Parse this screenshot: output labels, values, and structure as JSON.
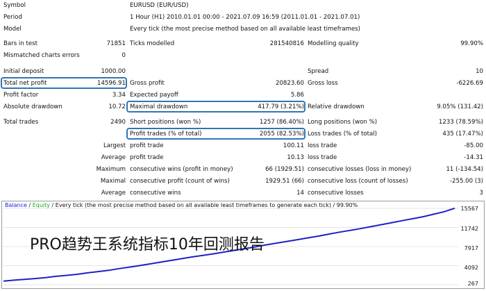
{
  "symbol": {
    "label": "Symbol",
    "value": "EURUSD (EUR/USD)"
  },
  "period": {
    "label": "Period",
    "value": "1 Hour (H1) 2010.01.01 00:00 - 2021.07.09 16:59 (2011.01.01 - 2021.07.01)"
  },
  "model": {
    "label": "Model",
    "value": "Every tick (the most precise method based on all available least timeframes)"
  },
  "bars_in_test": {
    "label": "Bars in test",
    "value": "71851"
  },
  "ticks_modelled": {
    "label": "Ticks modelled",
    "value": "281540816"
  },
  "modelling_quality": {
    "label": "Modelling quality",
    "value": "99.90%"
  },
  "mismatched": {
    "label": "Mismatched charts errors",
    "value": "0"
  },
  "initial_deposit": {
    "label": "Initial deposit",
    "value": "1000.00"
  },
  "spread": {
    "label": "Spread",
    "value": "10"
  },
  "total_net_profit": {
    "label": "Total net profit",
    "value": "14596.91"
  },
  "gross_profit": {
    "label": "Gross profit",
    "value": "20823.60"
  },
  "gross_loss": {
    "label": "Gross loss",
    "value": "-6226.69"
  },
  "profit_factor": {
    "label": "Profit factor",
    "value": "3.34"
  },
  "expected_payoff": {
    "label": "Expected payoff",
    "value": "5.86"
  },
  "absolute_drawdown": {
    "label": "Absolute drawdown",
    "value": "10.72"
  },
  "maximal_drawdown": {
    "label": "Maximal drawdown",
    "value": "417.79 (3.21%)"
  },
  "relative_drawdown": {
    "label": "Relative drawdown",
    "value": "9.05% (131.42)"
  },
  "total_trades": {
    "label": "Total trades",
    "value": "2490"
  },
  "short_positions": {
    "label": "Short positions (won %)",
    "value": "1257 (86.40%)"
  },
  "long_positions": {
    "label": "Long positions (won %)",
    "value": "1233 (78.59%)"
  },
  "profit_trades": {
    "label": "Profit trades (% of total)",
    "value": "2055 (82.53%)"
  },
  "loss_trades": {
    "label": "Loss trades (% of total)",
    "value": "435 (17.47%)"
  },
  "largest": {
    "label": "Largest",
    "profit_label": "profit trade",
    "profit_value": "100.11",
    "loss_label": "loss trade",
    "loss_value": "-85.00"
  },
  "average": {
    "label": "Average",
    "profit_label": "profit trade",
    "profit_value": "10.13",
    "loss_label": "loss trade",
    "loss_value": "-14.31"
  },
  "maximum": {
    "label": "Maximum",
    "wins_label": "consecutive wins (profit in money)",
    "wins_value": "66 (1929.51)",
    "losses_label": "consecutive losses (loss in money)",
    "losses_value": "11 (-134.54)"
  },
  "maximal": {
    "label": "Maximal",
    "profit_label": "consecutive profit (count of wins)",
    "profit_value": "1929.51 (66)",
    "loss_label": "consecutive loss (count of losses)",
    "loss_value": "-255.00 (3)"
  },
  "average2": {
    "label": "Average",
    "wins_label": "consecutive wins",
    "wins_value": "14",
    "losses_label": "consecutive losses",
    "losses_value": "3"
  },
  "chart_legend": {
    "balance": "Balance",
    "sep": " / ",
    "equity": "Equity",
    "rest": " / Every tick (the most precise method based on all available least timeframes to generate each tick) / 99.90%"
  },
  "overlay_text": "PRO趋势王系统指标10年回测报告",
  "colors": {
    "highlight_box": "#2f75b5",
    "balance_line": "#1f1fc8",
    "grid": "#c8c8c8"
  },
  "chart_data": {
    "type": "line",
    "series": [
      {
        "name": "Balance",
        "values": [
          1000,
          1180,
          1350,
          1500,
          1700,
          1950,
          2150,
          2350,
          2650,
          2900,
          3150,
          3500,
          3800,
          4100,
          4450,
          4800,
          5150,
          5500,
          5850,
          6150,
          6450,
          6800,
          7150,
          7500,
          7850,
          8250,
          8600,
          8950,
          9300,
          9650,
          10000,
          10400,
          10800,
          11150,
          11500,
          11900,
          12300,
          12700,
          13100,
          13500,
          13900,
          14400,
          14900,
          15597
        ]
      }
    ],
    "x": [
      0,
      1,
      2,
      3,
      4,
      5,
      6,
      7,
      8,
      9,
      10,
      11,
      12,
      13,
      14,
      15,
      16,
      17,
      18,
      19,
      20,
      21,
      22,
      23,
      24,
      25,
      26,
      27,
      28,
      29,
      30,
      31,
      32,
      33,
      34,
      35,
      36,
      37,
      38,
      39,
      40,
      41,
      42,
      43
    ],
    "y_ticks": [
      "15567",
      "11742",
      "7917",
      "4092",
      "267"
    ],
    "y_tick_values": [
      15567,
      11742,
      7917,
      4092,
      267
    ]
  }
}
